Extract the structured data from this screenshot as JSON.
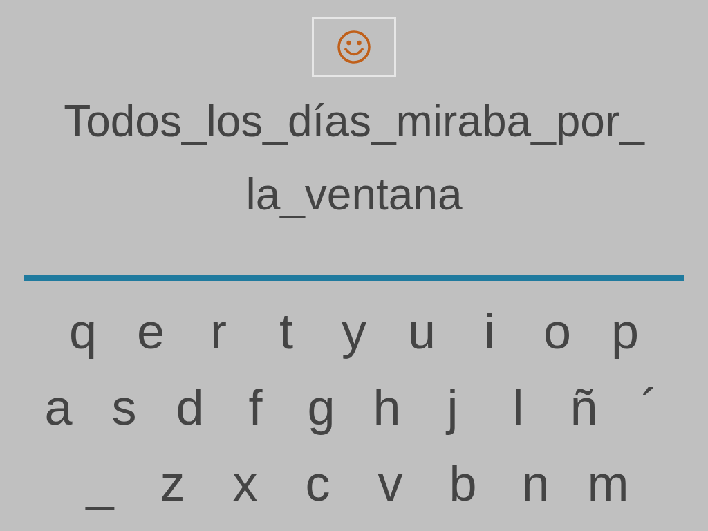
{
  "phrase_lines": [
    "Todos_los_días_miraba_por_",
    "la_ventana"
  ],
  "keyboard_rows": [
    [
      "q",
      "e",
      "r",
      "t",
      "y",
      "u",
      "i",
      "o",
      "p"
    ],
    [
      "a",
      "s",
      "d",
      "f",
      "g",
      "h",
      "j",
      "l",
      "ñ",
      "´"
    ],
    [
      "_",
      "z",
      "x",
      "c",
      "v",
      "b",
      "n",
      "m"
    ]
  ]
}
